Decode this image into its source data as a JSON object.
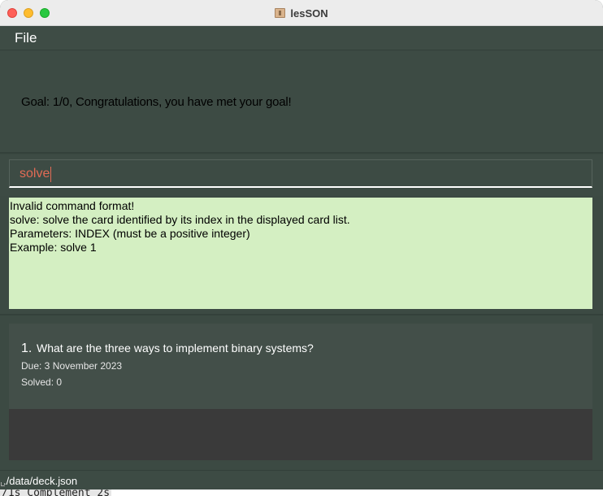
{
  "window": {
    "title": "lesSON"
  },
  "menu": {
    "items": [
      "File"
    ]
  },
  "goal": {
    "text": "Goal: 1/0, Congratulations, you have met your goal!"
  },
  "command": {
    "value": "solve"
  },
  "result": {
    "lines": [
      "Invalid command format!",
      "solve: solve the card identified by its index in the displayed card list.",
      "Parameters: INDEX (must be a positive integer)",
      "Example: solve 1"
    ]
  },
  "cards": [
    {
      "index": "1.",
      "question": "What are the three ways to implement binary systems?",
      "due": "Due: 3 November 2023",
      "solved": "Solved: 0"
    }
  ],
  "status": {
    "path": "./data/deck.json"
  },
  "background": {
    "terminal_text": "/1s Complement  2s"
  },
  "colors": {
    "panel": "#3d4b44",
    "result_bg": "#d4efc2",
    "command_text": "#e26b55",
    "close": "#fe5f57",
    "minimize": "#febc2e",
    "maximize": "#28c840"
  }
}
